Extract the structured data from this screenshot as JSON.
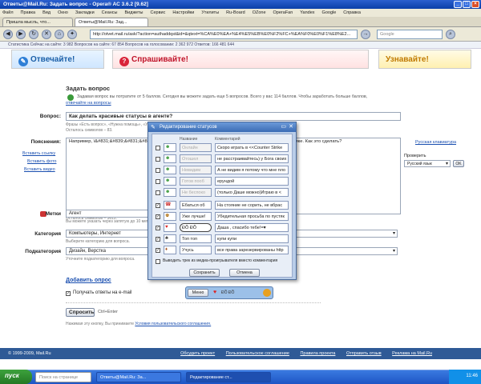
{
  "window": {
    "title": "Ответы@Mail.Ru: Задать вопрос - Opera® AC 3.6.2 [9.62]"
  },
  "menu": [
    "Файл",
    "Правка",
    "Вид",
    "Окно",
    "Закладки",
    "Сеансы",
    "Виджеты",
    "Сервис",
    "Настройки",
    "Утилиты",
    "Ru-Board",
    "OZone",
    "OperaFan",
    "Yandex",
    "Google",
    "Справка"
  ],
  "tabs": [
    "Пришла мысль, что...",
    "Ответы@Mail.Ru: Зад..."
  ],
  "address": "http://otvet.mail.ru/ask/?action=authaddqst&id=&qtext=%CA%E0%EA+%E4%E5%EB%E0%F2%FC+%EA%F0%E0%F1%E8%E2...",
  "search_placeholder": "Google",
  "info_strip": "Статистика    Сейчас на сайте: 3 982    Вопросов на сайте: 67 854    Вопросов на голосовании: 2 362 972    Ответов: 166 481 644",
  "banners": {
    "answer": "Отвечайте!",
    "ask": "Спрашивайте!",
    "learn": "Узнавайте!"
  },
  "ask": {
    "heading": "Задать вопрос",
    "points_text": "Задавая вопрос вы потратите от 5 баллов. Сегодня вы можете задать еще 5 вопросов. Всего у вас 114 баллов. Чтобы заработать больше баллов,",
    "points_link": "отвечайте на вопросы",
    "question_label": "Вопрос:",
    "question_value": "Как делать красивые статусы в агенте?",
    "question_hint": "Фразы «Есть вопрос», «Нужна помощь», «У меня вопрос» не нужны.",
    "chars_left": "Осталось символов – 83.",
    "details_label": "Пояснения:",
    "details_value": "Например, ï&#831;&#839;&#831;&#839;ò&#831;&#839;&#831;&#839; ... - Это будет как Di.Xak,только в рамке. Как это сделать?",
    "insert_link": "Вставить ссылку",
    "insert_photo": "Вставить фото",
    "insert_video": "Вставить видео",
    "chars_left2": "Осталось символов – 3612.",
    "keyboard_link": "Русская клавиатура",
    "check_label": "Проверить",
    "lang_value": "Русский язык",
    "ok": "OK",
    "tags_label": "Метки",
    "tags_value": "Агент",
    "tags_hint": "Вы можете указать через запятую до 10 меток.",
    "category_label": "Категория",
    "category_value": "Компьютеры, Интернет",
    "category_hint": "Выберите категорию для вопроса.",
    "subcategory_label": "Подкатегория",
    "subcategory_value": "Дизайн, Верстка",
    "subcategory_hint": "Уточните подкатегорию для вопроса.",
    "poll_link": "Добавить опрос",
    "email_label": "Получать ответы на e-mail",
    "submit": "Спросить",
    "submit_hint": "Ctrl+Enter",
    "terms_prefix": "Нажимая эту кнопку, Вы принимаете",
    "terms_link": "Условия пользовательского соглашения."
  },
  "footer": {
    "copyright": "© 1999-2009, Mail.Ru",
    "links": [
      "Обсудить проект",
      "Пользовательское соглашение",
      "Правила проекта",
      "Отправить отзыв",
      "Реклама на Mail.Ru"
    ]
  },
  "dialog": {
    "title": "Редактирование статусов",
    "col_name": "Название",
    "col_comment": "Комментарий",
    "rows": [
      {
        "checked": false,
        "icon": "☻",
        "name": "Онлайн",
        "comment": "Скоро играть в <<Counter Strike",
        "dim": true
      },
      {
        "checked": false,
        "icon": "☻",
        "name": "Отошел",
        "comment": "не расстраивайтесь) у Бога своих",
        "dim": true
      },
      {
        "checked": false,
        "icon": "☻",
        "name": "Невидим",
        "comment": "А не видим я потому что мне пло",
        "dim": true
      },
      {
        "checked": false,
        "icon": "☻",
        "name": "Готов пооб",
        "comment": "ерундой",
        "dim": true
      },
      {
        "checked": false,
        "icon": "☻",
        "name": "Не беспоко",
        "comment": "(только Даше можно)Играю в <",
        "dim": true
      },
      {
        "checked": true,
        "icon": "☎",
        "name": "Ебаться об",
        "comment": "На стояние не сорить, не вбрас",
        "dim": false
      },
      {
        "checked": true,
        "icon": "♚",
        "name": "Уже лучше!",
        "comment": "Убедительная просьба по пустяк",
        "dim": false
      },
      {
        "checked": true,
        "icon": "♥",
        "name": "ÐÕ ÐÕ",
        "comment": "Даша , спасибо тебе!=♥",
        "dim": false
      },
      {
        "checked": true,
        "icon": "♣",
        "name": "Топ топ",
        "comment": "купи купи",
        "dim": false
      },
      {
        "checked": true,
        "icon": "♦",
        "name": "Учусь",
        "comment": "все права зарезервированы http",
        "dim": false
      }
    ],
    "trek_label": "Выводить трек из медиа-проигрывателя вместо комментария",
    "save": "Сохранить",
    "cancel": "Отмена"
  },
  "menu_popup": "Меню",
  "taskbar": {
    "start": "пуск",
    "search": "Поиск на странице",
    "tasks": [
      "Ответы@Mail.Ru: За...",
      "Редактирование ст..."
    ],
    "clock": "11:46"
  }
}
